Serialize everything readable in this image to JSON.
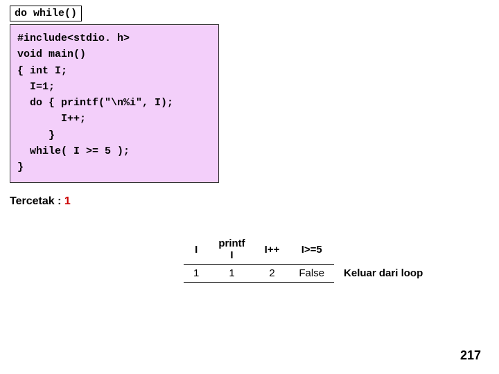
{
  "title": "do while()",
  "code": "#include<stdio. h>\nvoid main()\n{ int I;\n  I=1;\n  do { printf(\"\\n%i\", I);\n       I++;\n     }\n  while( I >= 5 );\n}",
  "tercetak_label": "Tercetak : ",
  "tercetak_value": "1",
  "table": {
    "headers": [
      "I",
      "printf\nI",
      "I++",
      "I>=5"
    ],
    "row": {
      "i": "1",
      "printf": "1",
      "ipp": "2",
      "cond": "False"
    },
    "note": "Keluar dari loop"
  },
  "page_number": "217"
}
